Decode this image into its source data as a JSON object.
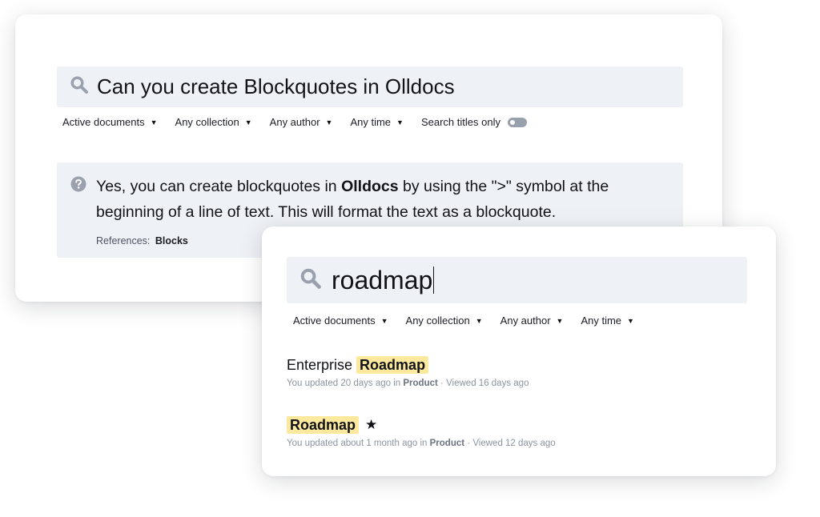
{
  "back_panel": {
    "search": {
      "query": "Can you create Blockquotes in Olldocs"
    },
    "filters": {
      "status": "Active documents",
      "collection": "Any collection",
      "author": "Any author",
      "time": "Any time",
      "titles_only_label": "Search titles only",
      "titles_only_enabled": false
    },
    "answer": {
      "part1": "Yes, you can create blockquotes in ",
      "brand": "Olldocs",
      "part2": " by using the \">\" symbol at the beginning of a line of text. This will format the text as a blockquote.",
      "references_label": "References:",
      "reference_link": "Blocks"
    }
  },
  "front_panel": {
    "search": {
      "query": "roadmap"
    },
    "filters": {
      "status": "Active documents",
      "collection": "Any collection",
      "author": "Any author",
      "time": "Any time"
    },
    "results": [
      {
        "title_prefix": "Enterprise",
        "title_highlight": "Roadmap",
        "meta_prefix": "You updated 20 days ago in",
        "collection": "Product",
        "viewed": "Viewed 16 days ago",
        "starred": false
      },
      {
        "title_prefix": "",
        "title_highlight": "Roadmap",
        "meta_prefix": "You updated about 1 month ago in",
        "collection": "Product",
        "viewed": "Viewed 12 days ago",
        "starred": true
      }
    ]
  },
  "icons": {
    "search": "search-icon",
    "help": "question-circle-icon",
    "dropdown": "caret-down-icon",
    "star": "star-icon"
  },
  "colors": {
    "search_bg": "#eef1f5",
    "highlight": "#fde99e",
    "muted_text": "#8c93a1",
    "icon_gray": "#9aa1ae"
  }
}
